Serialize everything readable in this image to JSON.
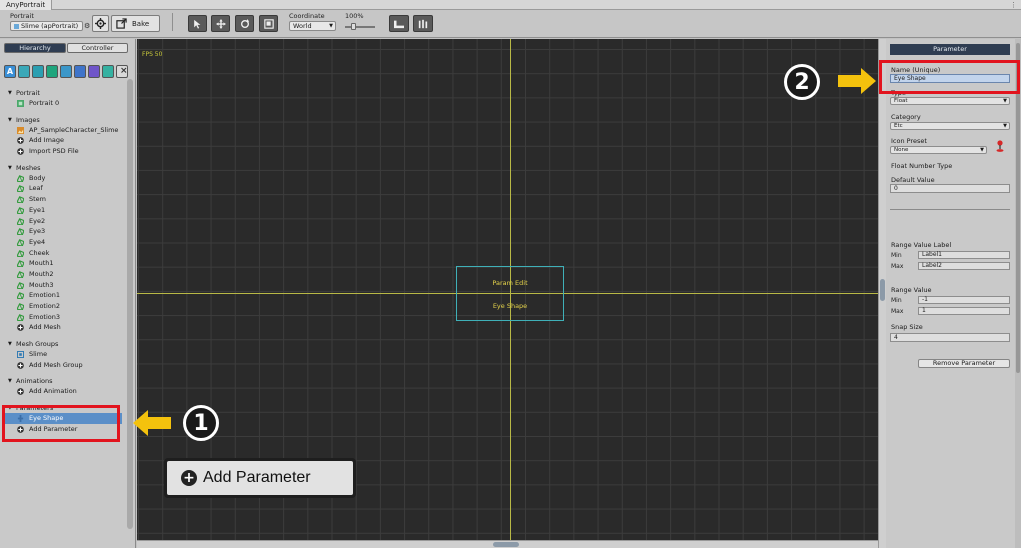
{
  "window": {
    "title": "AnyPortrait"
  },
  "toolbar": {
    "portrait_label": "Portrait",
    "portrait_value": "Slime (apPortrait)",
    "bake_label": "Bake",
    "coordinate_label": "Coordinate",
    "coordinate_value": "World",
    "zoom_value": "100%",
    "zoom_fraction": 0.25
  },
  "left_panel": {
    "tabs": [
      {
        "label": "Hierarchy",
        "active": true
      },
      {
        "label": "Controller",
        "active": false
      }
    ],
    "filter_buttons": [
      {
        "icon": "all-icon",
        "glyph": "A",
        "color": "#3a8fd6"
      },
      {
        "icon": "image-icon",
        "glyph": "",
        "color": "#3aa8b8"
      },
      {
        "icon": "mesh-icon",
        "glyph": "",
        "color": "#2b9fb1"
      },
      {
        "icon": "meshgroup-icon",
        "glyph": "",
        "color": "#1fa57d"
      },
      {
        "icon": "animation-icon",
        "glyph": "",
        "color": "#3b97c9"
      },
      {
        "icon": "control-icon",
        "glyph": "",
        "color": "#3f74c9"
      },
      {
        "icon": "parameter-icon",
        "glyph": "",
        "color": "#6f55c9"
      },
      {
        "icon": "bone-icon",
        "glyph": "",
        "color": "#35b1a1"
      },
      {
        "icon": "close-icon",
        "glyph": "",
        "color": "#d8d8d8"
      }
    ],
    "groups": [
      {
        "name": "Portrait",
        "items": [
          {
            "label": "Portrait 0",
            "icon": "portrait-icon"
          }
        ]
      },
      {
        "name": "Images",
        "items": [
          {
            "label": "AP_SampleCharacter_Slime",
            "icon": "image-icon"
          },
          {
            "label": "Add Image",
            "icon": "add-icon"
          },
          {
            "label": "Import PSD File",
            "icon": "add-icon"
          }
        ]
      },
      {
        "name": "Meshes",
        "items": [
          {
            "label": "Body",
            "icon": "mesh-icon"
          },
          {
            "label": "Leaf",
            "icon": "mesh-icon"
          },
          {
            "label": "Stem",
            "icon": "mesh-icon"
          },
          {
            "label": "Eye1",
            "icon": "mesh-icon"
          },
          {
            "label": "Eye2",
            "icon": "mesh-icon"
          },
          {
            "label": "Eye3",
            "icon": "mesh-icon"
          },
          {
            "label": "Eye4",
            "icon": "mesh-icon"
          },
          {
            "label": "Cheek",
            "icon": "mesh-icon"
          },
          {
            "label": "Mouth1",
            "icon": "mesh-icon"
          },
          {
            "label": "Mouth2",
            "icon": "mesh-icon"
          },
          {
            "label": "Mouth3",
            "icon": "mesh-icon"
          },
          {
            "label": "Emotion1",
            "icon": "mesh-icon"
          },
          {
            "label": "Emotion2",
            "icon": "mesh-icon"
          },
          {
            "label": "Emotion3",
            "icon": "mesh-icon"
          },
          {
            "label": "Add Mesh",
            "icon": "add-icon"
          }
        ]
      },
      {
        "name": "Mesh Groups",
        "items": [
          {
            "label": "Slime",
            "icon": "meshgroup-icon"
          },
          {
            "label": "Add Mesh Group",
            "icon": "add-icon"
          }
        ]
      },
      {
        "name": "Animations",
        "items": [
          {
            "label": "Add Animation",
            "icon": "add-icon"
          }
        ]
      },
      {
        "name": "Parameters",
        "items": [
          {
            "label": "Eye Shape",
            "icon": "parameter-icon",
            "selected": true
          },
          {
            "label": "Add Parameter",
            "icon": "add-icon"
          }
        ]
      }
    ]
  },
  "canvas": {
    "fps": "FPS 50",
    "param_box": {
      "line1": "Param Edit",
      "line2": "Eye Shape"
    }
  },
  "right_panel": {
    "header": "Parameter",
    "name_label": "Name (Unique)",
    "name_value": "Eye Shape",
    "type_label": "Type",
    "type_value": "Float",
    "category_label": "Category",
    "category_value": "Etc",
    "icon_preset_label": "Icon Preset",
    "icon_preset_value": "None",
    "float_type_label": "Float Number Type",
    "default_label": "Default Value",
    "default_value": "0",
    "range_label_title": "Range Value Label",
    "min_label": "Min",
    "max_label": "Max",
    "range_label_min": "Label1",
    "range_label_max": "Label2",
    "range_value_title": "Range Value",
    "range_min": "-1",
    "range_max": "1",
    "snap_label": "Snap Size",
    "snap_value": "4",
    "remove_button": "Remove Parameter"
  },
  "annotations": {
    "callout_1": "1",
    "callout_2": "2",
    "zoom_label": "Add Parameter",
    "highlight_color": "#e2141e",
    "arrow_color": "#f4c20d"
  }
}
